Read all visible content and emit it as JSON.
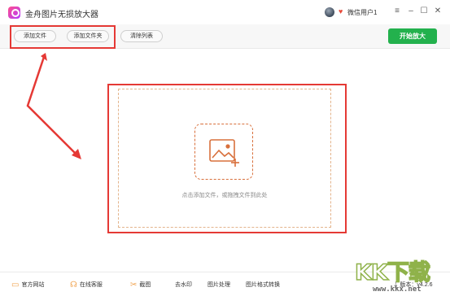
{
  "window": {
    "title": "金舟图片无损放大器",
    "user_name": "微信用户1",
    "controls": [
      "menu-icon",
      "minimize-icon",
      "maximize-icon",
      "close-icon"
    ]
  },
  "toolbar": {
    "add_file_label": "添加文件",
    "add_folder_label": "添加文件夹",
    "clear_list_label": "清除列表",
    "start_label": "开始放大"
  },
  "main": {
    "drop_hint": "点击添加文件，或拖拽文件到此处"
  },
  "statusbar": {
    "items": [
      {
        "label": "官方网站",
        "icon": "monitor-icon"
      },
      {
        "label": "在线客服",
        "icon": "headset-icon"
      },
      {
        "label": "截图",
        "icon": "scissors-icon"
      },
      {
        "label": "去水印"
      },
      {
        "label": "图片处理"
      },
      {
        "label": "图片格式转换"
      }
    ],
    "version_label": "版本：v4.2.6"
  },
  "watermark": {
    "text": "KK下载",
    "url": "www.kkx.net"
  },
  "colors": {
    "accent_green": "#23b14d",
    "highlight_red": "#e53935",
    "icon_orange": "#d8703c"
  }
}
